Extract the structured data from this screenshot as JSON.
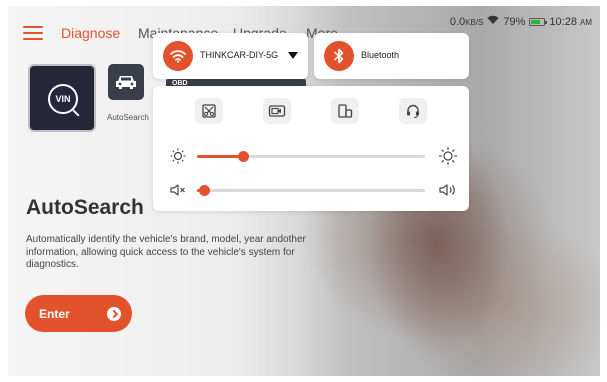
{
  "nav": {
    "tabs": [
      {
        "label": "Diagnose",
        "active": true
      },
      {
        "label": "Maintenance",
        "active": false
      },
      {
        "label": "Upgrade",
        "active": false
      },
      {
        "label": "More",
        "active": false
      }
    ]
  },
  "status_bar": {
    "speed_value": "0.0",
    "speed_unit": "KB/S",
    "battery": "79%",
    "time": "10:28",
    "ampm": "AM"
  },
  "tiles": {
    "vin_label": "VIN",
    "autosearch_caption": "AutoSearch",
    "obd_label": "OBD"
  },
  "hero": {
    "title": "AutoSearch",
    "description": "Automatically identify the vehicle's brand, model, year andother information, allowing quick access to the vehicle's system for diagnostics.",
    "enter_label": "Enter"
  },
  "quick_settings": {
    "wifi_name": "THINKCAR-DIY-5G",
    "bluetooth_label": "Bluetooth",
    "brightness_level": 0.2,
    "volume_level": 0.03
  },
  "colors": {
    "accent": "#e2532d",
    "tile_dark": "#27273a"
  },
  "icons": [
    "menu-icon",
    "wifi-icon",
    "bluetooth-icon",
    "screenshot-icon",
    "screen-record-icon",
    "rotate-screen-icon",
    "support-headset-icon",
    "brightness-low-icon",
    "brightness-high-icon",
    "volume-mute-icon",
    "volume-icon",
    "arrow-right-icon",
    "car-icon",
    "battery-icon"
  ]
}
